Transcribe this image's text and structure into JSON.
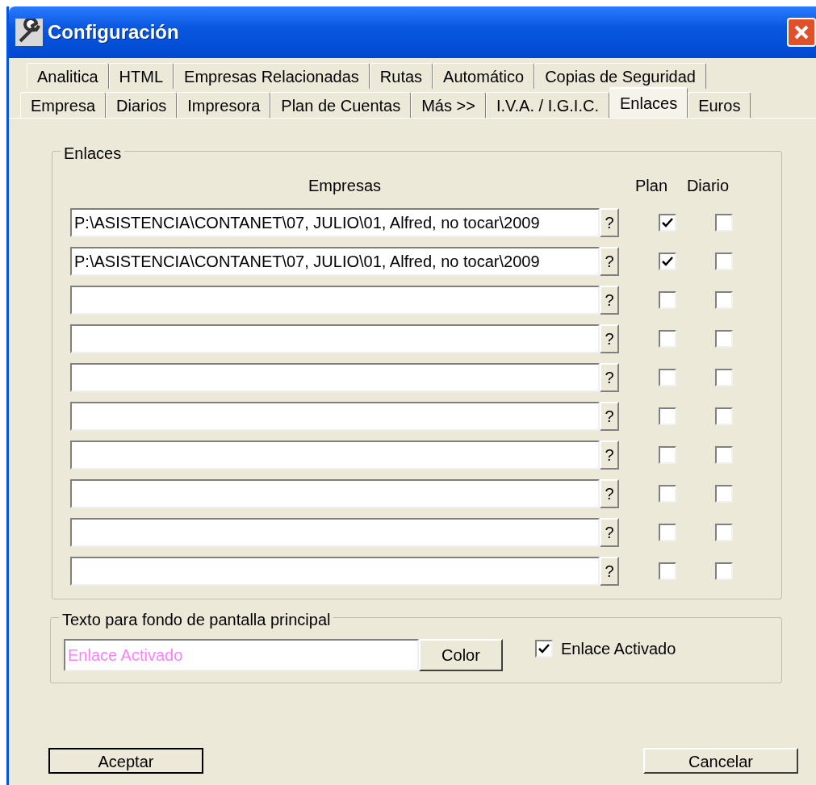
{
  "window": {
    "title": "Configuración"
  },
  "tab_rows": [
    [
      {
        "label": "Analitica",
        "selected": false
      },
      {
        "label": "HTML",
        "selected": false
      },
      {
        "label": "Empresas Relacionadas",
        "selected": false
      },
      {
        "label": "Rutas",
        "selected": false
      },
      {
        "label": "Automático",
        "selected": false
      },
      {
        "label": "Copias de Seguridad",
        "selected": false
      }
    ],
    [
      {
        "label": "Empresa",
        "selected": false
      },
      {
        "label": "Diarios",
        "selected": false
      },
      {
        "label": "Impresora",
        "selected": false
      },
      {
        "label": "Plan de Cuentas",
        "selected": false
      },
      {
        "label": "Más >>",
        "selected": false
      },
      {
        "label": "I.V.A. / I.G.I.C.",
        "selected": false
      },
      {
        "label": "Enlaces",
        "selected": true
      },
      {
        "label": "Euros",
        "selected": false
      }
    ]
  ],
  "links_group": {
    "title": "Enlaces",
    "columns": [
      "Empresas",
      "Plan",
      "Diario"
    ],
    "browse_label": "?",
    "rows": [
      {
        "path": "P:\\ASISTENCIA\\CONTANET\\07, JULIO\\01, Alfred, no tocar\\2009",
        "plan": true,
        "diario": false
      },
      {
        "path": "P:\\ASISTENCIA\\CONTANET\\07, JULIO\\01, Alfred, no tocar\\2009",
        "plan": true,
        "diario": false
      },
      {
        "plan": false,
        "diario": false
      },
      {
        "plan": false,
        "diario": false
      },
      {
        "plan": false,
        "diario": false
      },
      {
        "plan": false,
        "diario": false
      },
      {
        "plan": false,
        "diario": false
      },
      {
        "plan": false,
        "diario": false
      },
      {
        "plan": false,
        "diario": false
      },
      {
        "plan": false,
        "diario": false
      }
    ]
  },
  "background_group": {
    "title": "Texto para fondo de pantalla principal",
    "text": "Enlace Activado",
    "color_button": "Color",
    "checkbox": {
      "label": "Enlace Activado",
      "checked": true
    }
  },
  "buttons": [
    "Aceptar",
    "Cancelar"
  ]
}
